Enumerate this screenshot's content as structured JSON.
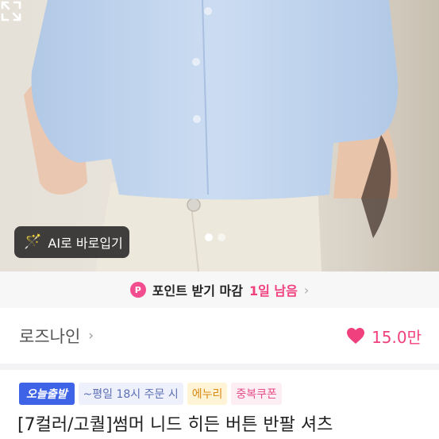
{
  "photo": {
    "ai_button_label": "AI로 바로입기",
    "page_count": 2,
    "active_page": 1
  },
  "point_banner": {
    "badge": "P",
    "text": "포인트 받기 마감",
    "remaining": "1일 남음",
    "arrow": "›"
  },
  "shop": {
    "name": "로즈나인",
    "chevron": "›",
    "likes": "15.0만"
  },
  "badges": {
    "today": "오늘출발",
    "shipping": "~평일 18시 주문 시",
    "point": "에누리",
    "coupon": "중복쿠폰"
  },
  "product": {
    "title": "[7컬러/고퀄]썸머 니드 히든 버튼 반팔 셔츠"
  },
  "colors": {
    "accent_pink": "#f0407e",
    "badge_blue": "#3f63e6"
  }
}
